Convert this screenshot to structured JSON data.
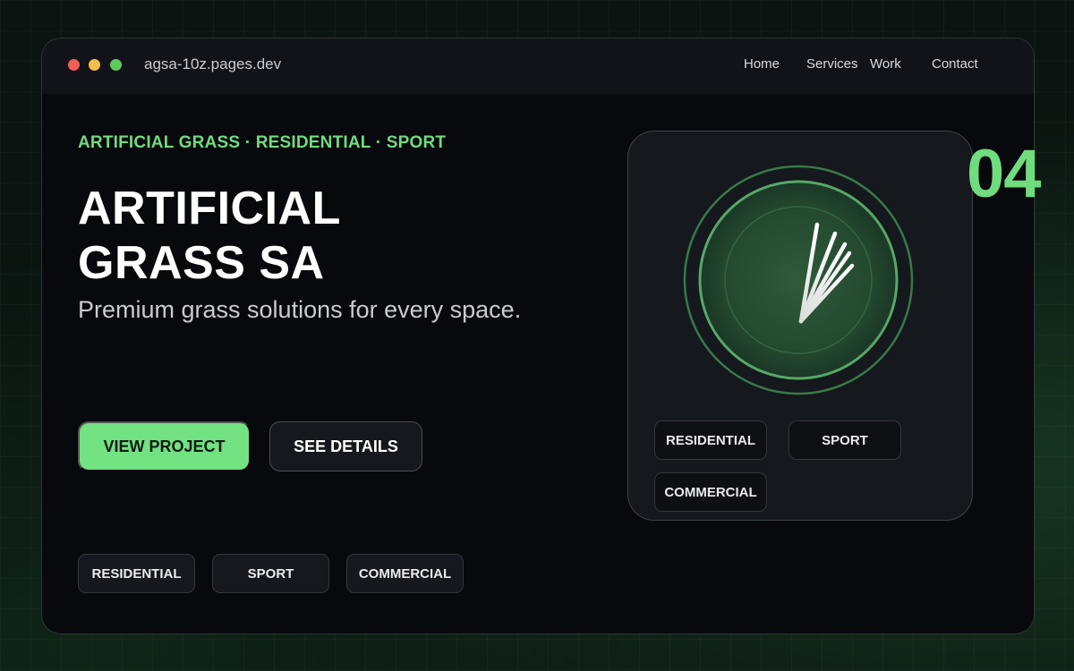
{
  "browser": {
    "url": "agsa-10z.pages.dev"
  },
  "nav": {
    "items": [
      "Home",
      "Services",
      "Work",
      "Contact"
    ]
  },
  "hero": {
    "eyebrow": "ARTIFICIAL GRASS · RESIDENTIAL · SPORT",
    "title_line1": "ARTIFICIAL",
    "title_line2": "GRASS SA",
    "subtitle": "Premium grass solutions for every space."
  },
  "buttons": {
    "primary_label": "VIEW PROJECT",
    "secondary_label": "SEE DETAILS"
  },
  "tags": [
    "RESIDENTIAL",
    "SPORT",
    "COMMERCIAL"
  ],
  "card": {
    "tags": [
      "RESIDENTIAL",
      "SPORT",
      "COMMERCIAL"
    ],
    "visual_icon": "grass-blades-icon"
  },
  "badge": {
    "number": "04"
  },
  "colors": {
    "accent": "#72e283",
    "background": "#07090d",
    "window_dots": [
      "#ee5f58",
      "#f3be4c",
      "#5ecb5e"
    ]
  }
}
